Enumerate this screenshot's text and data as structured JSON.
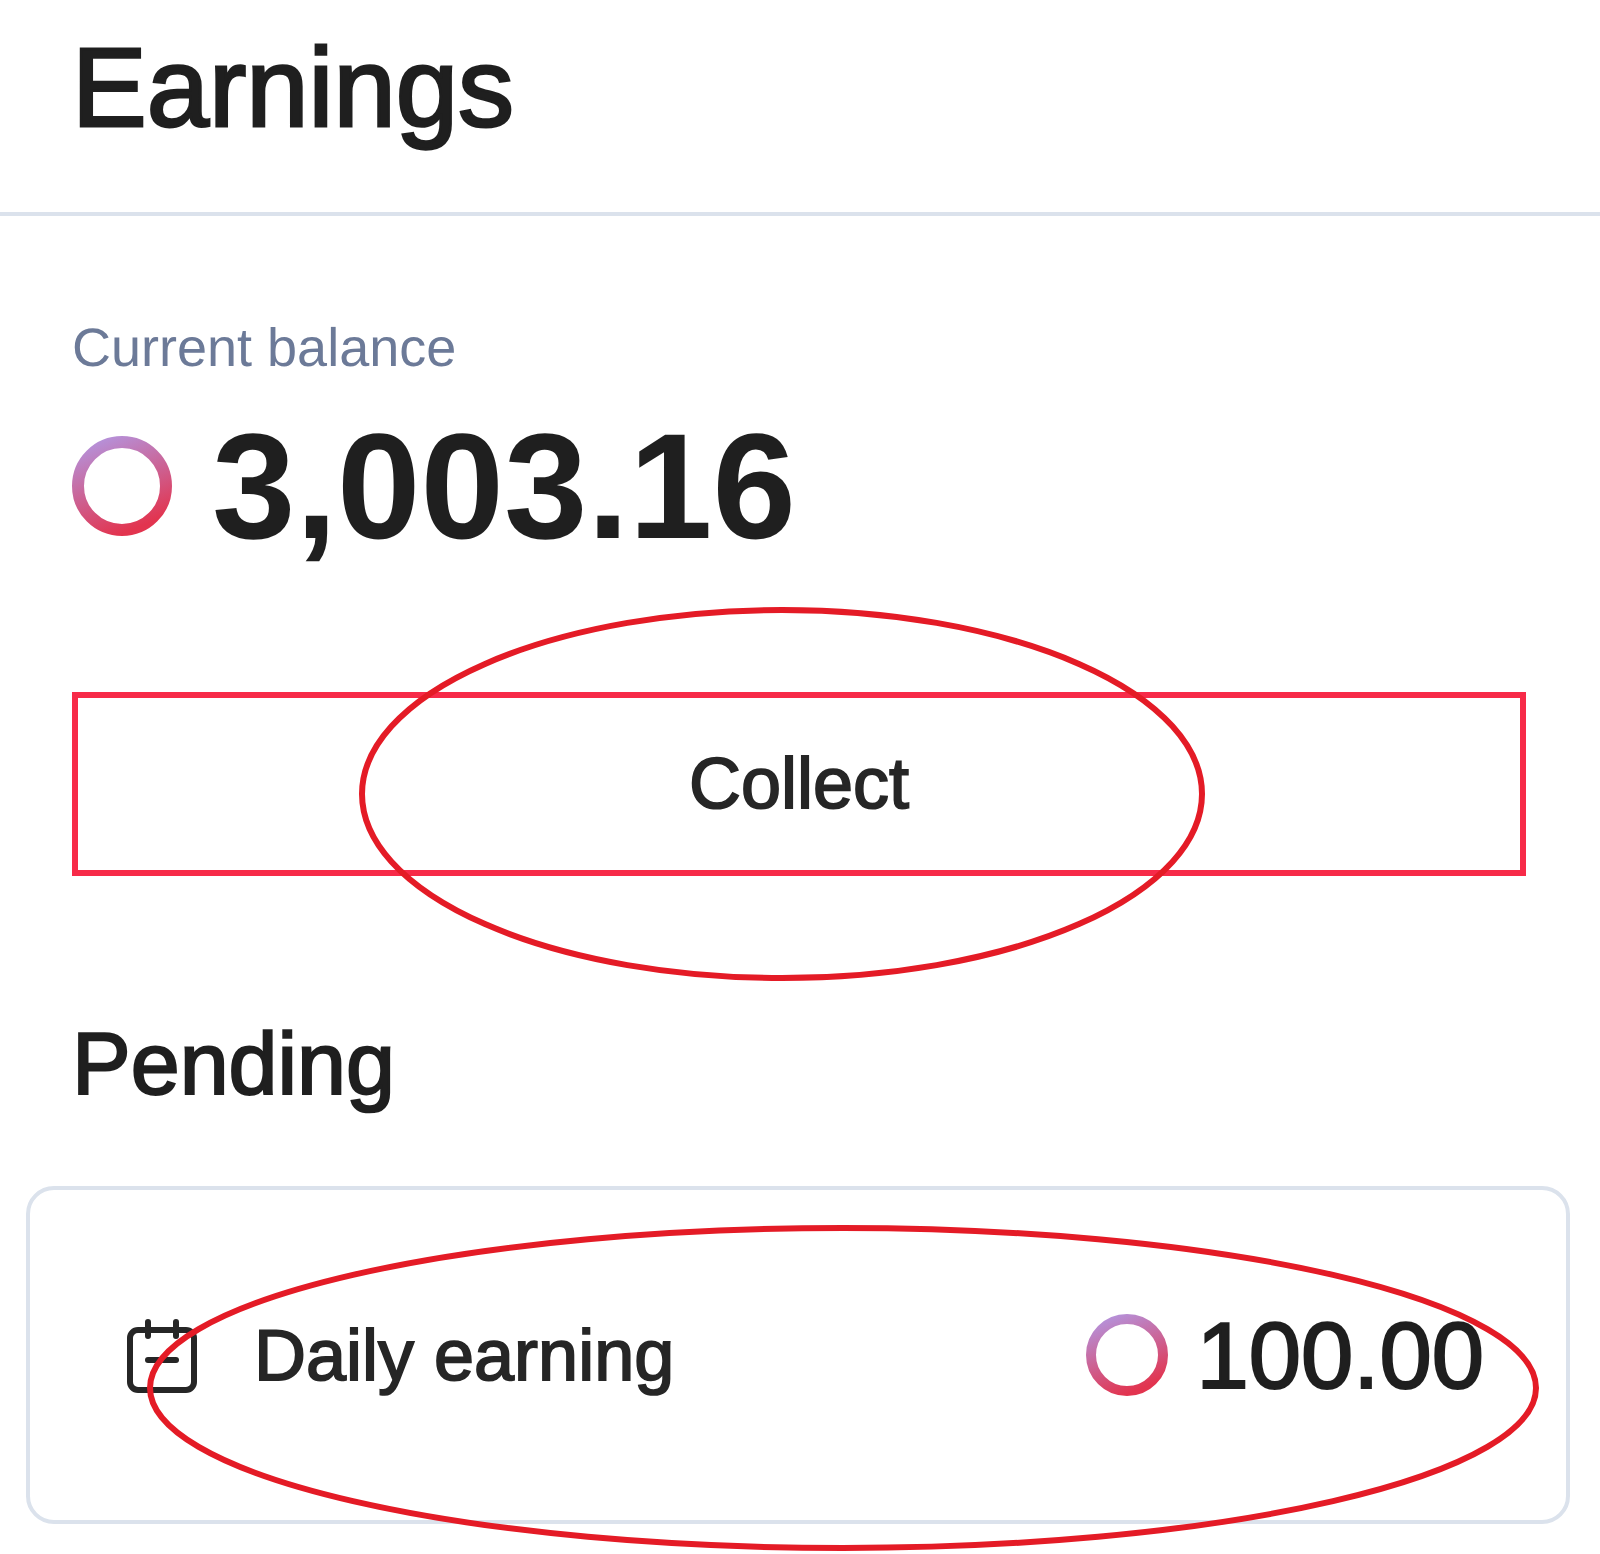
{
  "header": {
    "title": "Earnings"
  },
  "balance": {
    "label": "Current balance",
    "amount": "3,003.16"
  },
  "collect_button": {
    "label": "Collect",
    "annotations": [
      {
        "kind": "rectangle"
      },
      {
        "kind": "ellipse"
      }
    ]
  },
  "pending": {
    "title": "Pending",
    "items": [
      {
        "label": "Daily earning",
        "amount": "100.00",
        "annotations": [
          {
            "kind": "ellipse"
          }
        ]
      }
    ]
  }
}
